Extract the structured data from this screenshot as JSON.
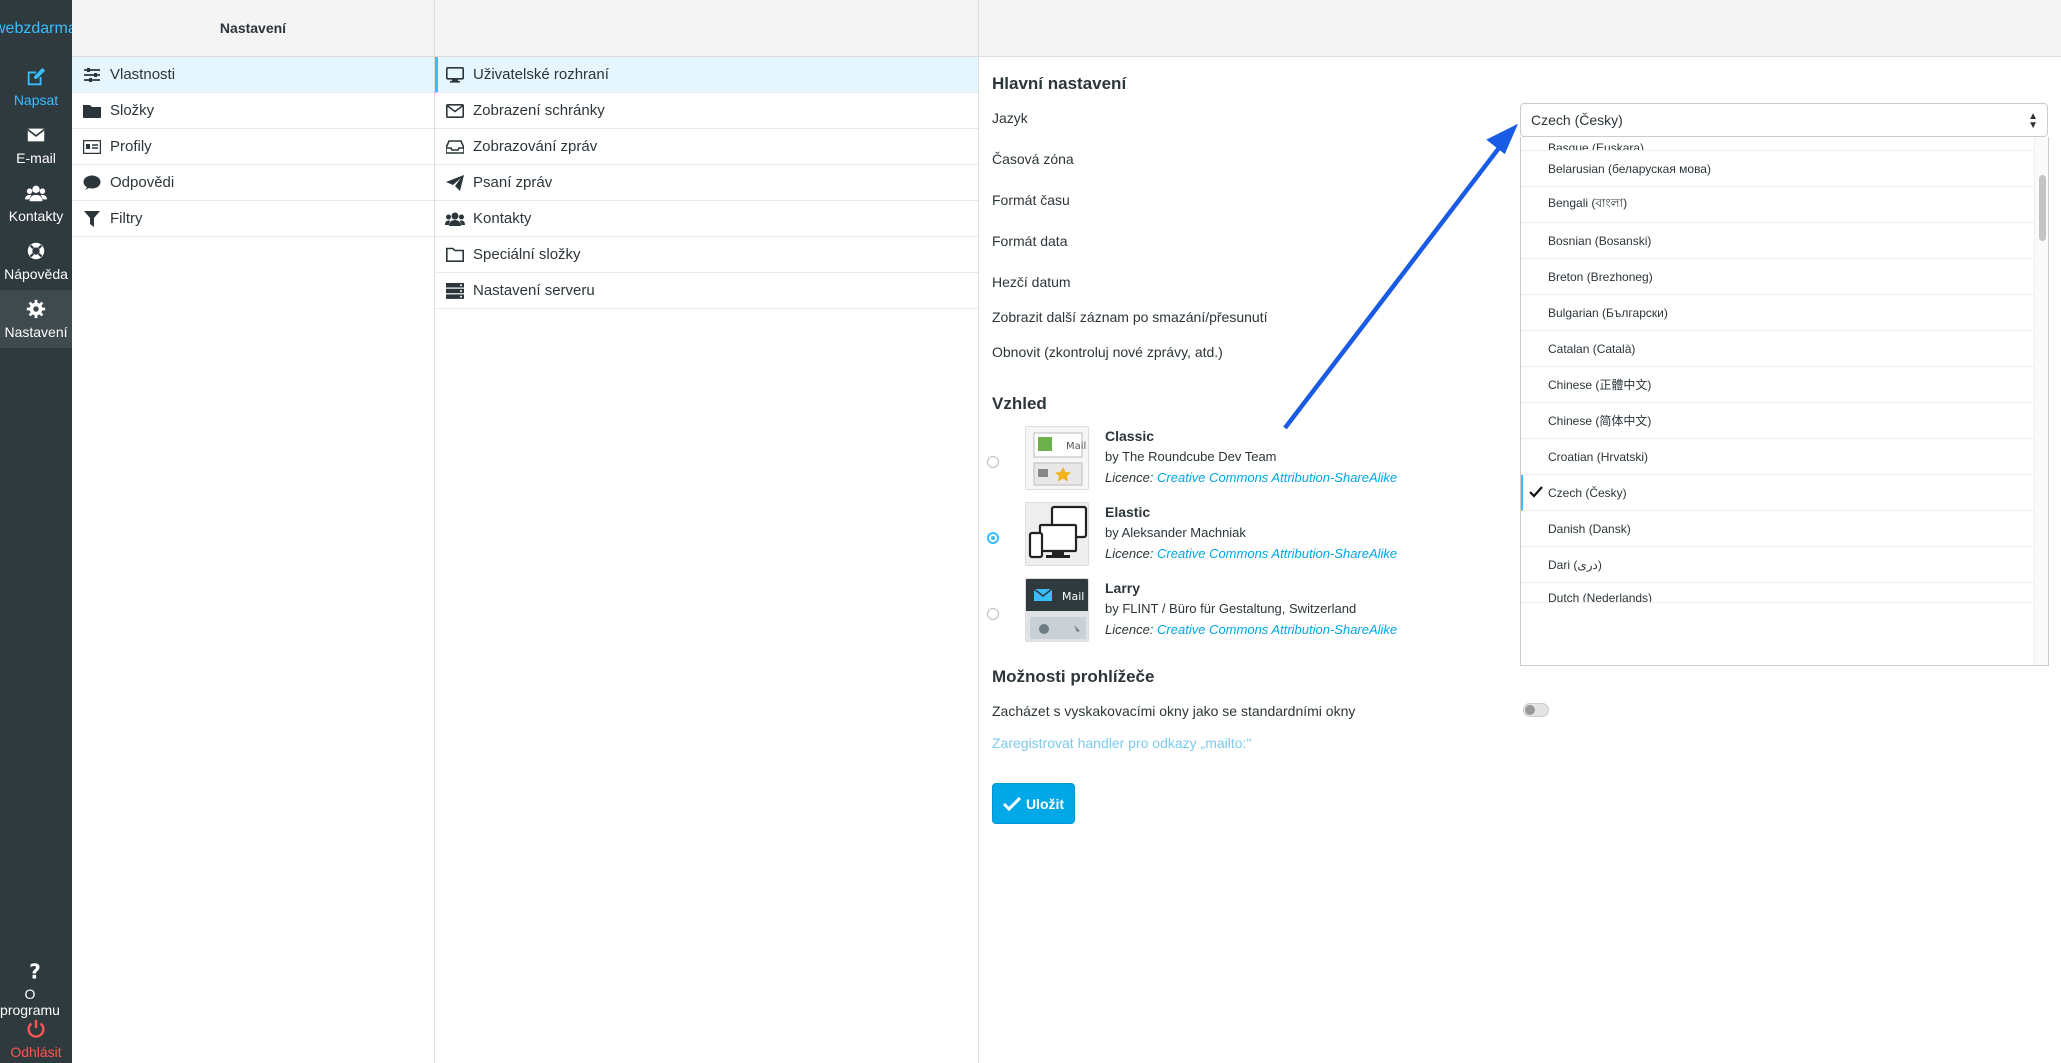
{
  "colors": {
    "accent": "#37beff",
    "button": "#00a8e8",
    "rail_bg": "#2f3a3f",
    "selected_bg": "#e5f6fe",
    "logout": "#ff5552",
    "annotation_arrow": "#1a5be6"
  },
  "logo": {
    "part1": "web",
    "part2": "zdarma"
  },
  "rail": {
    "compose": {
      "label": "Napsat",
      "icon": "compose-icon"
    },
    "mail": {
      "label": "E-mail",
      "icon": "envelope-icon"
    },
    "contacts": {
      "label": "Kontakty",
      "icon": "users-icon"
    },
    "help": {
      "label": "Nápověda",
      "icon": "lifebuoy-icon"
    },
    "settings": {
      "label": "Nastavení",
      "icon": "gear-icon"
    },
    "about": {
      "label": "O programu",
      "icon": "question-icon"
    },
    "logout": {
      "label": "Odhlásit",
      "icon": "power-icon"
    }
  },
  "col1": {
    "header": "Nastavení",
    "items": [
      {
        "label": "Vlastnosti",
        "icon": "sliders-icon"
      },
      {
        "label": "Složky",
        "icon": "folder-icon"
      },
      {
        "label": "Profily",
        "icon": "id-card-icon"
      },
      {
        "label": "Odpovědi",
        "icon": "comment-icon"
      },
      {
        "label": "Filtry",
        "icon": "filter-icon"
      }
    ]
  },
  "col2": {
    "items": [
      {
        "label": "Uživatelské rozhraní",
        "icon": "monitor-icon"
      },
      {
        "label": "Zobrazení schránky",
        "icon": "envelope-outline-icon"
      },
      {
        "label": "Zobrazování zpráv",
        "icon": "inbox-icon"
      },
      {
        "label": "Psaní zpráv",
        "icon": "paper-plane-icon"
      },
      {
        "label": "Kontakty",
        "icon": "users-icon"
      },
      {
        "label": "Speciální složky",
        "icon": "folder-outline-icon"
      },
      {
        "label": "Nastavení serveru",
        "icon": "server-icon"
      }
    ]
  },
  "main": {
    "section_main": "Hlavní nastavení",
    "rows": {
      "language": "Jazyk",
      "timezone": "Časová zóna",
      "time_format": "Formát času",
      "date_format": "Formát data",
      "pretty_date": "Hezčí datum",
      "display_next": "Zobrazit další záznam po smazání/přesunutí",
      "refresh": "Obnovit (zkontroluj nové zprávy, atd.)"
    },
    "language_select": {
      "value": "Czech (Česky)"
    },
    "language_options": [
      "Basque (Euskara)",
      "Belarusian (беларуская мова)",
      "Bengali (বাংলা)",
      "Bosnian (Bosanski)",
      "Breton (Brezhoneg)",
      "Bulgarian (Български)",
      "Catalan (Català)",
      "Chinese (正體中文)",
      "Chinese (简体中文)",
      "Croatian (Hrvatski)",
      "Czech (Česky)",
      "Danish (Dansk)",
      "Dari (دری)",
      "Dutch (Nederlands)"
    ],
    "section_skin": "Vzhled",
    "skins": [
      {
        "name": "Classic",
        "author": "by The Roundcube Dev Team",
        "licence_label": "Licence:",
        "licence": "Creative Commons Attribution-ShareAlike",
        "selected": false
      },
      {
        "name": "Elastic",
        "author": "by Aleksander Machniak",
        "licence_label": "Licence:",
        "licence": "Creative Commons Attribution-ShareAlike",
        "selected": true
      },
      {
        "name": "Larry",
        "author": "by FLINT / Büro für Gestaltung, Switzerland",
        "licence_label": "Licence:",
        "licence": "Creative Commons Attribution-ShareAlike",
        "selected": false
      }
    ],
    "thumb_text": {
      "classic": "Mail",
      "larry": "Mail"
    },
    "section_browser": "Možnosti prohlížeče",
    "popup_label": "Zacházet s vyskakovacími okny jako se standardními okny",
    "popup_enabled": false,
    "mailto_link": "Zaregistrovat handler pro odkazy „mailto:\"",
    "save_button": "Uložit"
  }
}
